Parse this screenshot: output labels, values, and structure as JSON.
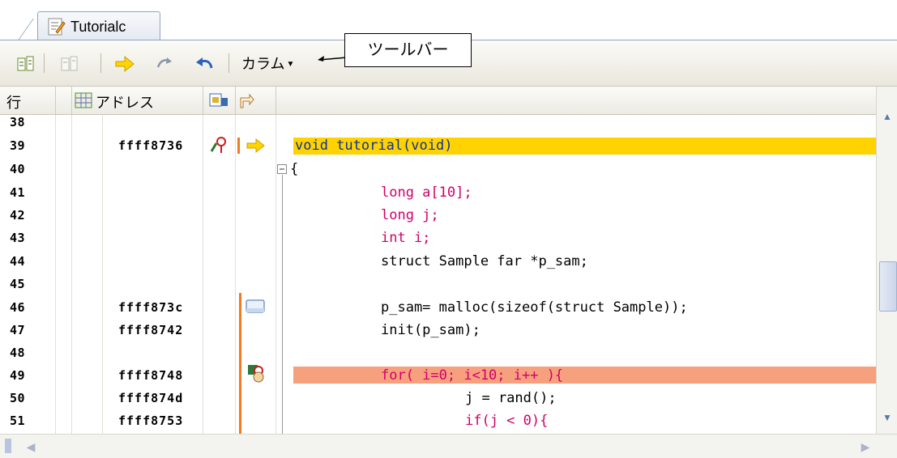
{
  "tab": {
    "label": "Tutorialc",
    "icon": "source-file-icon"
  },
  "toolbar": {
    "buttons": [
      {
        "name": "go-to-source-button",
        "icon": "source-view-icon"
      },
      {
        "name": "mixed-display-button",
        "icon": "mixed-view-icon"
      },
      {
        "name": "go-to-pc-button",
        "icon": "yellow-arrow-icon"
      },
      {
        "name": "step-over-button",
        "icon": "step-over-icon"
      },
      {
        "name": "return-button",
        "icon": "undo-arrow-icon"
      }
    ],
    "column_menu_label": "カラム"
  },
  "callout": {
    "text": "ツールバー"
  },
  "columns": {
    "line": "行",
    "address": "アドレス"
  },
  "rows": [
    {
      "line": "38",
      "address": "",
      "code": ""
    },
    {
      "line": "39",
      "address": "ffff8736",
      "code": "void tutorial(void)",
      "highlight": "current-pc"
    },
    {
      "line": "40",
      "address": "",
      "code": "{"
    },
    {
      "line": "41",
      "address": "",
      "code": "long a[10];"
    },
    {
      "line": "42",
      "address": "",
      "code": "long j;"
    },
    {
      "line": "43",
      "address": "",
      "code": "int i;"
    },
    {
      "line": "44",
      "address": "",
      "code": "struct Sample far *p_sam;"
    },
    {
      "line": "45",
      "address": "",
      "code": ""
    },
    {
      "line": "46",
      "address": "ffff873c",
      "code": "p_sam= malloc(sizeof(struct Sample));"
    },
    {
      "line": "47",
      "address": "ffff8742",
      "code": "init(p_sam);"
    },
    {
      "line": "48",
      "address": "",
      "code": ""
    },
    {
      "line": "49",
      "address": "ffff8748",
      "code": "for( i=0; i<10; i++ ){",
      "highlight": "breakpoint"
    },
    {
      "line": "50",
      "address": "ffff874d",
      "code": "j = rand();"
    },
    {
      "line": "51",
      "address": "ffff8753",
      "code": "if(j < 0){"
    }
  ],
  "colors": {
    "current_pc": "#ffd200",
    "breakpoint": "#f7a07e",
    "keyword": "#d0006b",
    "coverage": "#f47a20"
  }
}
